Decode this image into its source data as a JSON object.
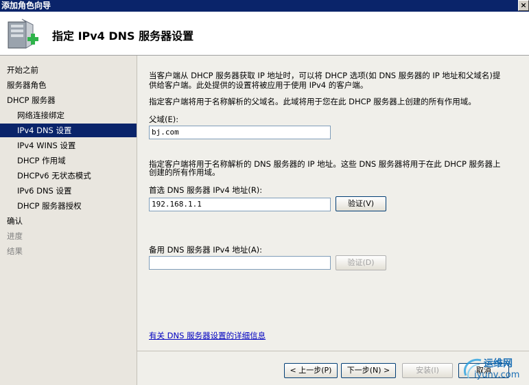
{
  "window": {
    "title": "添加角色向导",
    "close_glyph": "×"
  },
  "header": {
    "title": "指定 IPv4 DNS 服务器设置",
    "icon": "server-add-icon"
  },
  "nav": {
    "items": [
      {
        "label": "开始之前",
        "state": "normal"
      },
      {
        "label": "服务器角色",
        "state": "normal"
      },
      {
        "label": "DHCP 服务器",
        "state": "normal"
      },
      {
        "label": "网络连接绑定",
        "state": "sub"
      },
      {
        "label": "IPv4 DNS 设置",
        "state": "selected"
      },
      {
        "label": "IPv4 WINS 设置",
        "state": "sub"
      },
      {
        "label": "DHCP 作用域",
        "state": "sub"
      },
      {
        "label": "DHCPv6 无状态模式",
        "state": "sub"
      },
      {
        "label": "IPv6 DNS 设置",
        "state": "sub"
      },
      {
        "label": "DHCP 服务器授权",
        "state": "sub"
      },
      {
        "label": "确认",
        "state": "normal"
      },
      {
        "label": "进度",
        "state": "disabled"
      },
      {
        "label": "结果",
        "state": "disabled"
      }
    ]
  },
  "main": {
    "intro_line1": "当客户端从 DHCP 服务器获取 IP 地址时，可以将 DHCP 选项(如 DNS 服务器的 IP 地址和父域名)提",
    "intro_line2": "供给客户端。此处提供的设置将被应用于使用 IPv4 的客户端。",
    "parent_domain_desc": "指定客户端将用于名称解析的父域名。此域将用于您在此 DHCP 服务器上创建的所有作用域。",
    "parent_domain_label": "父域(E):",
    "parent_domain_value": "bj.com",
    "dns_desc_line1": "指定客户端将用于名称解析的 DNS 服务器的 IP 地址。这些 DNS 服务器将用于在此 DHCP 服务器上",
    "dns_desc_line2": "创建的所有作用域。",
    "preferred_label": "首选 DNS 服务器 IPv4 地址(R):",
    "preferred_value": "192.168.1.1",
    "validate_label": "验证(V)",
    "alternate_label": "备用 DNS 服务器 IPv4 地址(A):",
    "alternate_value": "",
    "validate2_label": "验证(D)",
    "more_info_link": "有关 DNS 服务器设置的详细信息"
  },
  "footer": {
    "back_label": "< 上一步(P)",
    "next_label": "下一步(N) >",
    "install_label": "安装(I)",
    "cancel_label": "取消"
  },
  "watermark": {
    "text1": "运维网",
    "text2": "iyunv.com"
  },
  "colors": {
    "selected_nav": "#0a246a",
    "title_bar": "#0a246a",
    "link": "#0000c0",
    "nav_bg": "#e9e6df",
    "content_bg": "#f0efea"
  }
}
